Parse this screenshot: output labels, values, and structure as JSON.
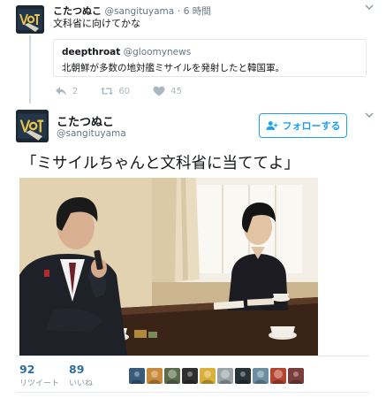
{
  "parent_tweet": {
    "display_name": "こたつぬこ",
    "screen_name": "@sangituyama",
    "separator": "·",
    "time": "6 時間",
    "text": "文科省に向けてかな",
    "quote": {
      "display_name": "deepthroat",
      "screen_name": "@gloomynews",
      "text": "北朝鮮が多数の地対艦ミサイルを発射したと韓国軍。"
    },
    "actions": {
      "reply_count": "2",
      "retweet_count": "60",
      "like_count": "45"
    }
  },
  "main_tweet": {
    "display_name": "こたつぬこ",
    "screen_name": "@sangituyama",
    "follow_label": "フォローする",
    "text": "「ミサイルちゃんと文科省に当ててよ」"
  },
  "stats": {
    "retweets": {
      "count": "92",
      "label": "リツイート"
    },
    "likes": {
      "count": "89",
      "label": "いいね"
    }
  },
  "likers": [
    {
      "name": "liker-avatar-1",
      "color": "#3a5a7a"
    },
    {
      "name": "liker-avatar-2",
      "color": "#c68a3a"
    },
    {
      "name": "liker-avatar-3",
      "color": "#5b6b4a"
    },
    {
      "name": "liker-avatar-4",
      "color": "#2f2f2f"
    },
    {
      "name": "liker-avatar-5",
      "color": "#d8b03a"
    },
    {
      "name": "liker-avatar-6",
      "color": "#9aa3a8"
    },
    {
      "name": "liker-avatar-7",
      "color": "#263238"
    },
    {
      "name": "liker-avatar-8",
      "color": "#6d8ea0"
    },
    {
      "name": "liker-avatar-9",
      "color": "#b5442f"
    },
    {
      "name": "liker-avatar-10",
      "color": "#7a3d3d"
    }
  ],
  "colors": {
    "accent": "#1da1f2",
    "stat_number": "#2d6fa3",
    "muted": "#657786"
  }
}
